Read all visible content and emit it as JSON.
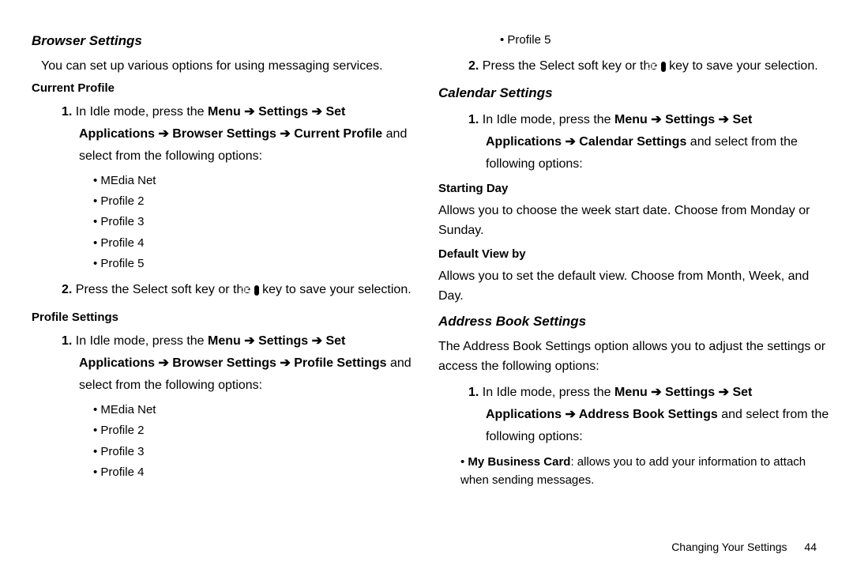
{
  "left": {
    "h_browser": "Browser Settings",
    "browser_intro": "You can set up various options for using messaging services.",
    "h_current_profile": "Current Profile",
    "step1_prefix": "In Idle mode, press the ",
    "menu_path_browser_current": "Menu ➔ Settings ➔ Set Applications ➔ Browser Settings ➔ Current Profile",
    "step1_suffix": " and select from the following options:",
    "profiles5": [
      "MEdia Net",
      "Profile 2",
      "Profile 3",
      "Profile 4",
      "Profile 5"
    ],
    "step2_a": "Press the Select soft key or the ",
    "step2_b": " key to save your selection.",
    "h_profile_settings": "Profile Settings",
    "menu_path_browser_profile": "Menu ➔ Settings ➔ Set Applications ➔ Browser Settings ➔ Profile Settings",
    "profiles4": [
      "MEdia Net",
      "Profile 2",
      "Profile 3",
      "Profile 4"
    ]
  },
  "right": {
    "profile5": "Profile 5",
    "step2_a": "Press the Select soft key or the ",
    "step2_b": " key to save your selection.",
    "h_calendar": "Calendar Settings",
    "step1_prefix": "In Idle mode, press the ",
    "menu_path_calendar": "Menu ➔ Settings ➔ Set Applications ➔ Calendar Settings",
    "cal_suffix": " and select from the following options:",
    "h_starting_day": "Starting Day",
    "starting_day_body": "Allows you to choose the week start date. Choose from Monday or Sunday.",
    "h_default_view": "Default View by",
    "default_view_body": "Allows you to set the default view. Choose from Month, Week, and Day.",
    "h_address": "Address Book Settings",
    "address_intro": "The Address Book Settings option allows you to adjust the settings or access the following options:",
    "menu_path_address": "Menu ➔ Settings ➔ Set Applications ➔ Address Book Settings",
    "mbc_label": "My Business Card",
    "mbc_body": ": allows you to add your information to attach when sending messages."
  },
  "ok_label": "OK",
  "num1": "1.",
  "num2": "2.",
  "footer_section": "Changing Your Settings",
  "footer_page": "44"
}
